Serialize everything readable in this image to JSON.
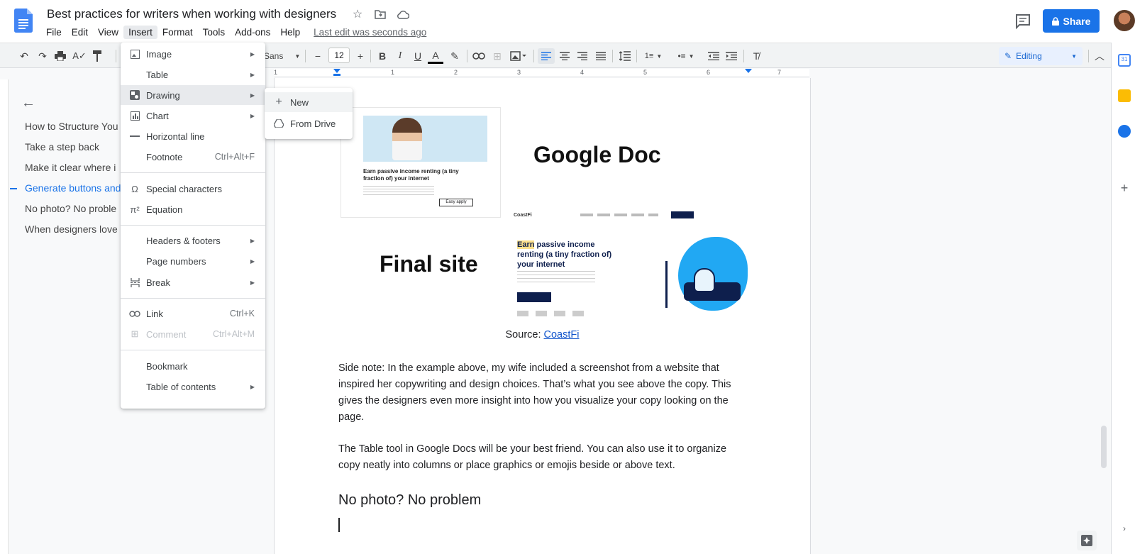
{
  "app": {
    "title": "Best practices for writers when working with designers",
    "share_label": "Share",
    "last_edit": "Last edit was seconds ago"
  },
  "menubar": [
    "File",
    "Edit",
    "View",
    "Insert",
    "Format",
    "Tools",
    "Add-ons",
    "Help"
  ],
  "toolbar": {
    "font": "Sans",
    "font_size": "12",
    "mode": "Editing"
  },
  "ruler": [
    "1",
    "1",
    "2",
    "3",
    "4",
    "5",
    "6",
    "7"
  ],
  "outline": {
    "items": [
      "How to Structure You",
      "Take a step back",
      "Make it clear where i",
      "Generate buttons and",
      "No photo? No proble",
      "When designers love"
    ],
    "active_index": 3
  },
  "insert_menu": {
    "items": [
      {
        "label": "Image",
        "icon": "image-icon",
        "arrow": true
      },
      {
        "label": "Table",
        "icon": "",
        "arrow": true
      },
      {
        "label": "Drawing",
        "icon": "drawing-icon",
        "arrow": true
      },
      {
        "label": "Chart",
        "icon": "chart-icon",
        "arrow": true
      },
      {
        "label": "Horizontal line",
        "icon": "horizontal-line-icon",
        "arrow": false
      },
      {
        "label": "Footnote",
        "icon": "",
        "shortcut": "Ctrl+Alt+F"
      },
      {
        "label": "Special characters",
        "icon": "omega-icon"
      },
      {
        "label": "Equation",
        "icon": "pi-icon"
      },
      {
        "label": "Headers & footers",
        "icon": "",
        "arrow": true
      },
      {
        "label": "Page numbers",
        "icon": "",
        "arrow": true
      },
      {
        "label": "Break",
        "icon": "page-break-icon",
        "arrow": true
      },
      {
        "label": "Link",
        "icon": "link-icon",
        "shortcut": "Ctrl+K"
      },
      {
        "label": "Comment",
        "icon": "comment-icon",
        "shortcut": "Ctrl+Alt+M",
        "disabled": true
      },
      {
        "label": "Bookmark",
        "icon": ""
      },
      {
        "label": "Table of contents",
        "icon": "",
        "arrow": true
      }
    ]
  },
  "drawing_submenu": [
    {
      "label": "New",
      "icon": "plus-icon"
    },
    {
      "label": "From Drive",
      "icon": "drive-icon"
    }
  ],
  "document": {
    "image1": {
      "headline": "Earn passive income renting (a tiny fraction of) your internet",
      "button": "Easy apply"
    },
    "label_google_doc": "Google Doc",
    "label_final_site": "Final site",
    "image2": {
      "logo": "CoastFi",
      "headline_highlight": "Earn",
      "headline_rest": " passive income renting (a tiny fraction of) your internet"
    },
    "caption_prefix": "Source: ",
    "caption_link": "CoastFi",
    "paragraph1": "Side note: In the example above, my wife included a screenshot from a website that inspired her copywriting and design choices. That’s what you see above the copy. This gives the designers even more insight into how you visualize your copy looking on the page.",
    "paragraph2": "The Table tool in Google Docs will be your best friend. You can also use it to organize copy neatly into columns or place graphics or emojis beside or above text.",
    "heading": "No photo? No problem"
  },
  "colors": {
    "accent": "#1a73e8",
    "menu_hover": "#e8eaed",
    "toolbar_bg": "#f1f3f4"
  }
}
